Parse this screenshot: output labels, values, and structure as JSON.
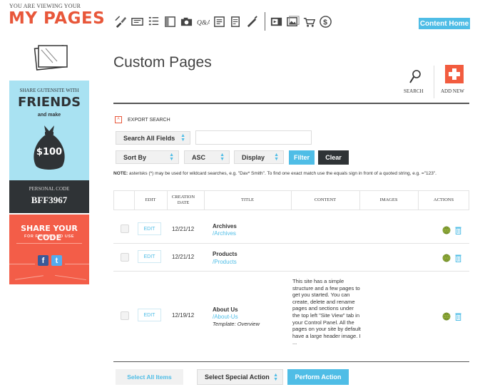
{
  "header": {
    "viewing_label": "YOU ARE VIEWING YOUR",
    "title": "MY PAGES",
    "content_home": "Content Home",
    "toolbar_icons": [
      "brush-icon",
      "ticket-icon",
      "list-icon",
      "layout-icon",
      "camera-icon",
      "qa-icon",
      "book-icon",
      "calendar-icon",
      "pen-icon",
      "media-icon",
      "photos-icon",
      "cart-icon",
      "dollar-icon"
    ]
  },
  "sidebar": {
    "promo": {
      "line1": "SHARE GUTENSITE WITH",
      "headline": "FRIENDS",
      "line2": "and make",
      "amount": "$100",
      "code_label": "PERSONAL CODE",
      "code": "BFF3967"
    },
    "share": {
      "title": "SHARE YOUR CODE",
      "subtitle": "FOR FRIENDS TO USE",
      "facebook": "f",
      "twitter": "t"
    }
  },
  "main": {
    "title": "Custom Pages",
    "search_label": "SEARCH",
    "add_label": "ADD NEW",
    "export_label": "EXPORT SEARCH",
    "export_toggle": "^",
    "search_field_select": "Search All Fields",
    "sort_by": "Sort By",
    "sort_order": "ASC",
    "display": "Display",
    "filter_btn": "Filter",
    "clear_btn": "Clear",
    "note_bold": "NOTE:",
    "note_text": " asterisks (*) may be used for wildcard searches, e.g. \"Dav* Smith\". To find one exact match use the equals sign in front of a quoted string, e.g. =\"123\".",
    "columns": [
      "EDIT",
      "CREATION DATE",
      "TITLE",
      "CONTENT",
      "IMAGES",
      "ACTIONS"
    ],
    "rows": [
      {
        "edit": "EDIT",
        "date": "12/21/12",
        "title": "Archives",
        "path": "/Archives",
        "template": "",
        "content": ""
      },
      {
        "edit": "EDIT",
        "date": "12/21/12",
        "title": "Products",
        "path": "/Products",
        "template": "",
        "content": ""
      },
      {
        "edit": "EDIT",
        "date": "12/19/12",
        "title": "About Us",
        "path": "/About-Us",
        "template": "Template: Overview",
        "content": "This site has a simple structure and a few pages to get you started. You can create, delete and rename pages and sections under the top left \"Site View\" tab in your Control Panel. All the pages on your site by default have a large header image. I ..."
      }
    ],
    "select_all": "Select All Items",
    "special_action": "Select Special Action",
    "perform_action": "Perform Action"
  },
  "colors": {
    "accent": "#4fbde6",
    "brand": "#e8573a",
    "dark": "#2f3336",
    "promo_blue": "#a9e2f2",
    "promo_red": "#f35d48"
  }
}
